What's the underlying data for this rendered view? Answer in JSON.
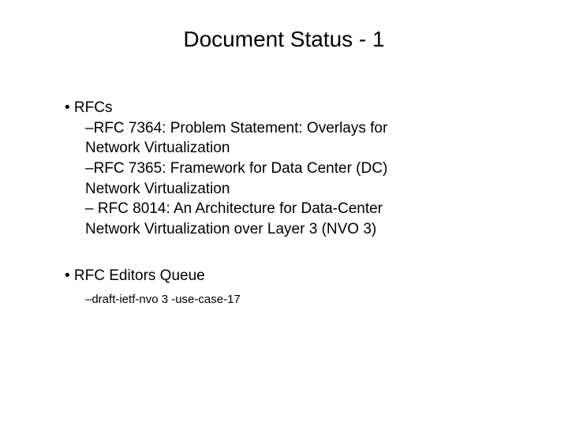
{
  "title": "Document Status - 1",
  "section1": {
    "heading": "• RFCs",
    "line1": "–RFC 7364: Problem Statement: Overlays for",
    "line2": "Network Virtualization",
    "line3": "–RFC 7365: Framework for Data Center (DC)",
    "line4": "Network Virtualization",
    "line5": "– RFC 8014:  An Architecture for Data-Center",
    "line6": "Network Virtualization over Layer 3 (NVO 3)"
  },
  "section2": {
    "heading": "• RFC Editors Queue",
    "line1": "–draft-ietf-nvo 3 -use-case-17"
  }
}
